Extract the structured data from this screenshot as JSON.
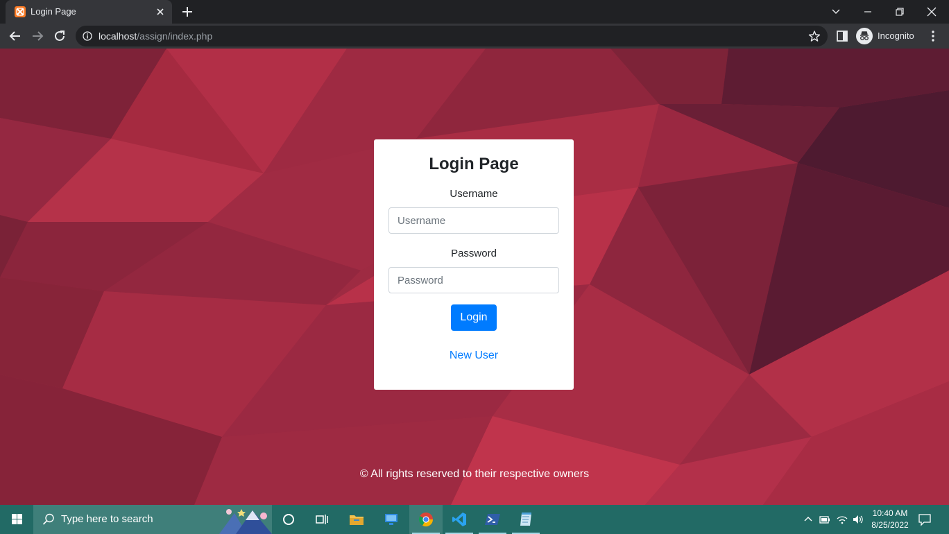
{
  "browser": {
    "tab_title": "Login Page",
    "url_host": "localhost",
    "url_path": "/assign/index.php",
    "profile_label": "Incognito",
    "icons": {
      "favicon": "xampp-favicon",
      "tab_close": "close-icon",
      "new_tab": "plus-icon",
      "tab_search": "chevron-down-icon",
      "minimize": "minimize-icon",
      "restore": "restore-icon",
      "close_window": "close-icon",
      "back": "arrow-left-icon",
      "forward": "arrow-right-icon",
      "reload": "reload-icon",
      "site_info": "info-icon",
      "bookmark": "star-icon",
      "side_panel": "side-panel-icon",
      "incognito": "incognito-icon",
      "menu": "kebab-menu-icon"
    }
  },
  "login": {
    "title": "Login Page",
    "username_label": "Username",
    "username_placeholder": "Username",
    "username_value": "",
    "password_label": "Password",
    "password_placeholder": "Password",
    "password_value": "",
    "button_label": "Login",
    "new_user_link": "New User"
  },
  "footer": {
    "text": "© All rights reserved to their respective owners"
  },
  "taskbar": {
    "search_placeholder": "Type here to search",
    "clock_time": "10:40 AM",
    "clock_date": "8/25/2022",
    "icons": [
      "windows-start-icon",
      "search-icon",
      "cortana-icon",
      "task-view-icon",
      "file-explorer-icon",
      "remote-desktop-icon",
      "chrome-icon",
      "vscode-icon",
      "powershell-icon",
      "notepad-icon",
      "chevron-up-icon",
      "battery-icon",
      "wifi-icon",
      "volume-icon",
      "notification-icon"
    ]
  },
  "colors": {
    "brand_blue": "#007bff",
    "page_background": "#9e2b42",
    "taskbar": "#226a65",
    "chrome_dark": "#202124",
    "chrome_toolbar": "#35363a"
  }
}
